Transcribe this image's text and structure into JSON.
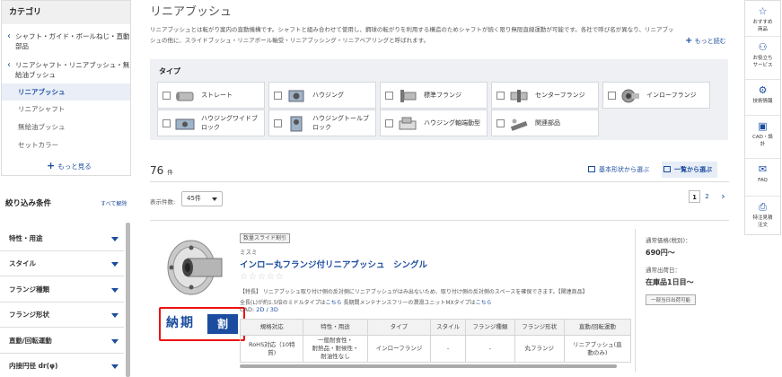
{
  "sidebar": {
    "title": "カテゴリ",
    "links": [
      {
        "label_1": "シャフト・ガイド・ボールねじ・直動",
        "label_2": "部品"
      },
      {
        "label_1": "リニアシャフト・リニアブッシュ・無",
        "label_2": "給油ブッシュ"
      }
    ],
    "items": [
      "リニアブッシュ",
      "リニアシャフト",
      "無給油ブッシュ",
      "セットカラー"
    ],
    "more": "もっと見る"
  },
  "filters": {
    "title": "絞り込み条件",
    "clear": "すべて解除",
    "items": [
      "特性・用途",
      "スタイル",
      "フランジ種類",
      "フランジ形状",
      "直動/回転運動",
      "内接円径 dr(φ)"
    ]
  },
  "main": {
    "title": "リニアブッシュ",
    "desc_line1": "リニアブッシュとは転がり案内の直動機構です。シャフトと組み合わせて使用し、鋼球の転がりを利用する構造のためシャフトが続く限り無限直線運動が可能です。各社で呼び名が異なり、リニアブッ",
    "desc_line2": "シュの他に、スライドブッシュ・リニアボール軸受・リニアブッシング・リニアベアリングと呼ばれます。",
    "desc_more": "もっと読む",
    "type_label": "タイプ",
    "types": [
      {
        "label_1": "ストレート",
        "label_2": ""
      },
      {
        "label_1": "ハウジング",
        "label_2": ""
      },
      {
        "label_1": "標準フランジ",
        "label_2": ""
      },
      {
        "label_1": "センターフランジ",
        "label_2": ""
      },
      {
        "label_1": "インローフランジ",
        "label_2": ""
      },
      {
        "label_1": "ハウジングワイドブ",
        "label_2": "ロック"
      },
      {
        "label_1": "ハウジングトールブ",
        "label_2": "ロック"
      },
      {
        "label_1": "ハウジング軸端動型",
        "label_2": ""
      },
      {
        "label_1": "関連部品",
        "label_2": ""
      }
    ],
    "count": "76",
    "count_unit": "件",
    "view_shape": "基本形状から選ぶ",
    "view_list": "一覧から選ぶ",
    "perpage_label": "表示件数:",
    "perpage_value": "45件",
    "pages": [
      "1",
      "2"
    ],
    "next": "›"
  },
  "product": {
    "tag": "数量スライド割引",
    "maker": "ミスミ",
    "name": "インロー丸フランジ付リニアブッシュ　シングル",
    "stars": "☆☆☆☆☆",
    "feature_1": "【特長】 リニアブッシュ取り付け側の反対側にリニアブッシュがはみ出ないため、取り付け側の反対側のスペースを確保できます。【関連商品】",
    "feature_2": "全長(L)が約1.5倍のミドルタイプは",
    "feature_link_1": "こちら",
    "feature_3": " 長期間メンテナンスフリーの潤滑ユニットMXタイプは",
    "feature_link_2": "こちら",
    "cad_label": "CAD:",
    "cad_value": "2D / 3D",
    "delivery_text": "納期",
    "delivery_mark": "割",
    "headers": [
      "規格対応",
      "特性・用途",
      "タイプ",
      "スタイル",
      "フランジ種類",
      "フランジ形状",
      "直動/回転運動"
    ],
    "values_1": [
      "RoHS対応（10特",
      "一般耐食性・",
      "インローフランジ",
      "-",
      "-",
      "丸フランジ",
      "リニアブッシュ(直"
    ],
    "values_2": [
      "質)",
      "耐熱品・耐候性・",
      "",
      "",
      "",
      "",
      "動のみ)"
    ],
    "values_3": [
      "",
      "耐油性なし",
      "",
      "",
      "",
      "",
      ""
    ],
    "price_label": "通常価格(税別)：",
    "price_value": "690円～",
    "ship_label": "通常出荷日：",
    "ship_value": "在庫品1日目～",
    "ship_btn": "一部当日出荷可能"
  },
  "rail": [
    {
      "label_1": "おすすめ",
      "label_2": "商品",
      "icon": "☆"
    },
    {
      "label_1": "お役立ち",
      "label_2": "サービス",
      "icon": "⚇"
    },
    {
      "label_1": "技術情報",
      "label_2": "",
      "icon": "⚙"
    },
    {
      "label_1": "CAD・設",
      "label_2": "計",
      "icon": "▣"
    },
    {
      "label_1": "FAQ",
      "label_2": "",
      "icon": "✉"
    },
    {
      "label_1": "特注見積",
      "label_2": "注文",
      "icon": "⎙"
    }
  ],
  "colors": {
    "accent": "#1b4c9f",
    "delivery_border": "#e11111"
  }
}
